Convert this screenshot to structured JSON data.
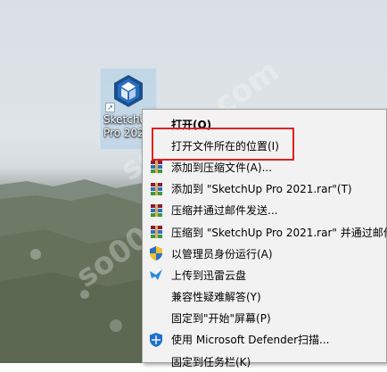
{
  "desktop": {
    "icon_label": "SketchUp\nPro 2021",
    "watermark": "so00u.com"
  },
  "context_menu": {
    "items": [
      {
        "label": "打开(O)",
        "icon": "none",
        "bold": true
      },
      {
        "label": "打开文件所在的位置(I)",
        "icon": "none",
        "bold": false,
        "highlighted": true
      },
      {
        "label": "添加到压缩文件(A)...",
        "icon": "winrar-icon"
      },
      {
        "label": "添加到 \"SketchUp Pro 2021.rar\"(T)",
        "icon": "winrar-icon"
      },
      {
        "label": "压缩并通过邮件发送...",
        "icon": "winrar-icon"
      },
      {
        "label": "压缩到 \"SketchUp Pro 2021.rar\" 并通过邮件",
        "icon": "winrar-icon"
      },
      {
        "label": "以管理员身份运行(A)",
        "icon": "uac-shield-icon"
      },
      {
        "label": "上传到迅雷云盘",
        "icon": "thunder-cloud-icon"
      },
      {
        "label": "兼容性疑难解答(Y)",
        "icon": "none"
      },
      {
        "label": "固定到\"开始\"屏幕(P)",
        "icon": "none"
      },
      {
        "label": "使用 Microsoft Defender扫描...",
        "icon": "defender-icon"
      },
      {
        "label": "固定到任务栏(K)",
        "icon": "none"
      }
    ]
  },
  "colors": {
    "highlight_border": "#e02020",
    "menu_bg": "#f2f2f2"
  }
}
